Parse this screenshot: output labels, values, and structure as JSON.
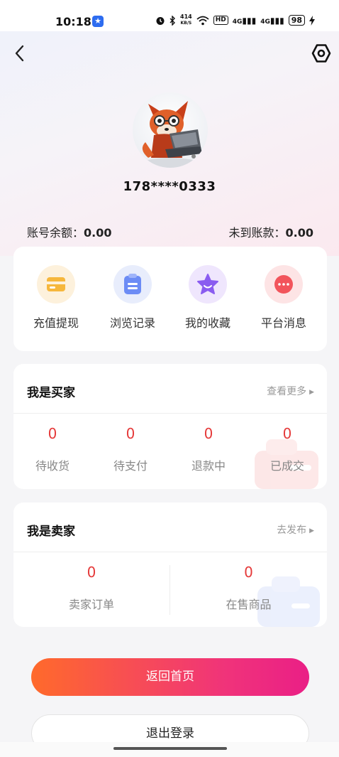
{
  "status_bar": {
    "time": "10:18",
    "net_speed_value": "414",
    "net_speed_unit": "KB/S",
    "hd_label": "HD",
    "signal1": "4G",
    "signal2": "4G",
    "battery": "98"
  },
  "profile": {
    "phone": "178****0333"
  },
  "balance": {
    "account_label": "账号余额：",
    "account_value": "0.00",
    "pending_label": "未到账款：",
    "pending_value": "0.00"
  },
  "actions": [
    {
      "label": "充值提现",
      "icon": "wallet-icon",
      "color": "#f6b73c"
    },
    {
      "label": "浏览记录",
      "icon": "clipboard-icon",
      "color": "#6c8cf5"
    },
    {
      "label": "我的收藏",
      "icon": "star-icon",
      "color": "#8a5cf0"
    },
    {
      "label": "平台消息",
      "icon": "message-icon",
      "color": "#f2545b"
    }
  ],
  "buyer": {
    "title": "我是买家",
    "more": "查看更多",
    "stats": [
      {
        "value": "0",
        "label": "待收货"
      },
      {
        "value": "0",
        "label": "待支付"
      },
      {
        "value": "0",
        "label": "退款中"
      },
      {
        "value": "0",
        "label": "已成交"
      }
    ]
  },
  "seller": {
    "title": "我是卖家",
    "more": "去发布",
    "stats": [
      {
        "value": "0",
        "label": "卖家订单"
      },
      {
        "value": "0",
        "label": "在售商品"
      }
    ]
  },
  "buttons": {
    "home": "返回首页",
    "logout": "退出登录"
  },
  "colors": {
    "accent_red": "#e53a3a",
    "gradient_start": "#ff6a2b",
    "gradient_end": "#ea1f86"
  }
}
